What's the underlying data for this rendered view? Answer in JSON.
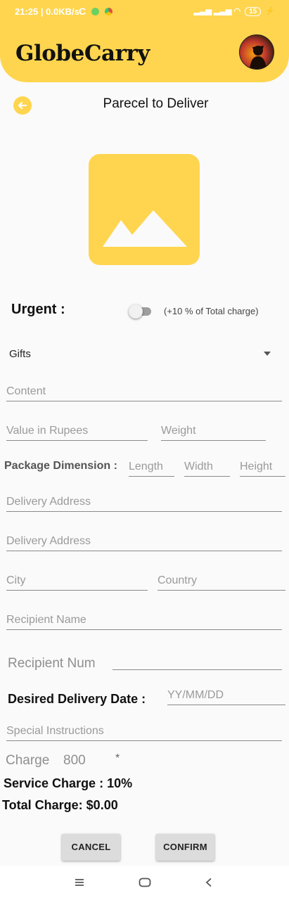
{
  "status_bar": {
    "time_speed": "21:25 | 0.0KB/s",
    "battery": "15"
  },
  "app": {
    "title": "GlobeCarry"
  },
  "page": {
    "title": "Parecel to Deliver"
  },
  "urgent": {
    "label": "Urgent :",
    "note": "(+10 % of Total charge)",
    "enabled": false
  },
  "category": {
    "selected": "Gifts"
  },
  "form": {
    "content_placeholder": "Content",
    "value_placeholder": "Value in Rupees",
    "weight_placeholder": "Weight",
    "dimension_label": "Package Dimension :",
    "length_placeholder": "Length",
    "width_placeholder": "Width",
    "height_placeholder": "Height",
    "address1_placeholder": "Delivery Address",
    "address2_placeholder": "Delivery Address",
    "city_placeholder": "City",
    "country_placeholder": "Country",
    "recipient_name_placeholder": "Recipient Name",
    "recipient_num_label": "Recipient Num",
    "delivery_date_label": "Desired Delivery Date :",
    "delivery_date_placeholder": "YY/MM/DD",
    "special_instructions_placeholder": "Special Instructions"
  },
  "charges": {
    "charge_label": "Charge",
    "charge_value": "800",
    "asterisk": "*",
    "service_charge": "Service Charge : 10%",
    "total_charge": "Total Charge: $0.00"
  },
  "actions": {
    "cancel_label": "CANCEL",
    "confirm_label": "CONFIRM"
  },
  "colors": {
    "accent": "#ffd54f"
  }
}
